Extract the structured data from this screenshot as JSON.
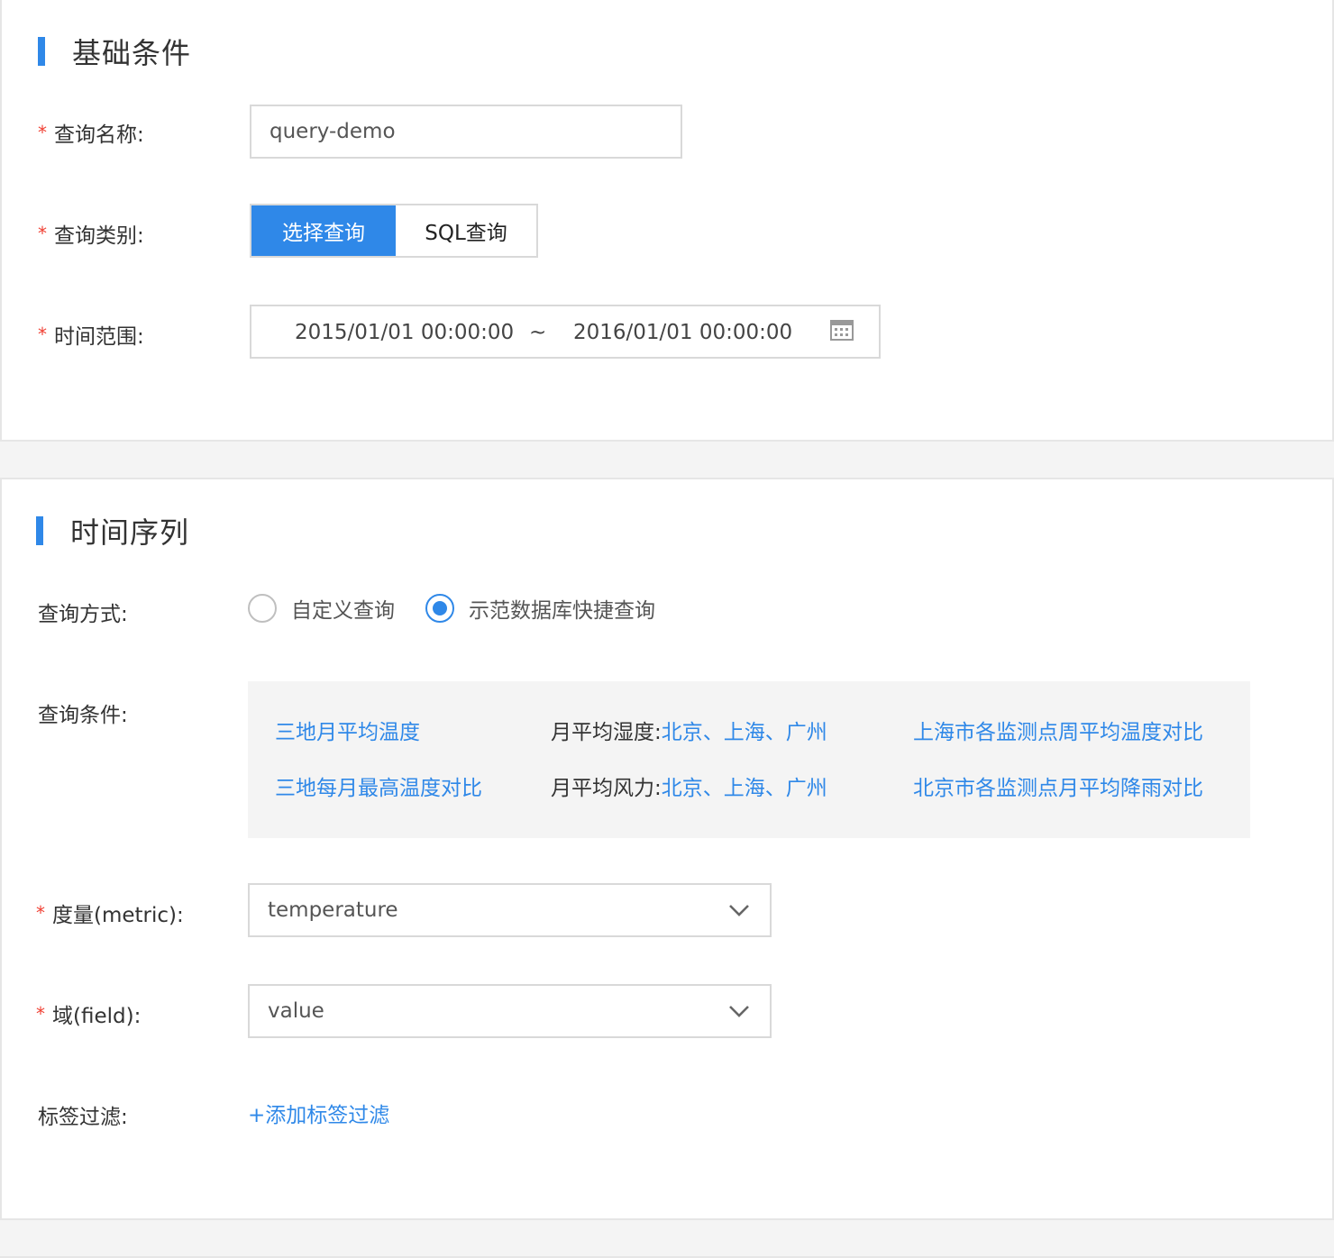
{
  "basic": {
    "title": "基础条件",
    "query_name": {
      "label": "查询名称:",
      "value": "query-demo"
    },
    "query_type": {
      "label": "查询类别:",
      "options": [
        "选择查询",
        "SQL查询"
      ],
      "selected": "选择查询"
    },
    "time_range": {
      "label": "时间范围:",
      "start": "2015/01/01 00:00:00",
      "separator": "~",
      "end": "2016/01/01 00:00:00"
    }
  },
  "timeseries": {
    "title": "时间序列",
    "query_mode": {
      "label": "查询方式:",
      "options": [
        "自定义查询",
        "示范数据库快捷查询"
      ],
      "selected": "示范数据库快捷查询"
    },
    "conditions": {
      "label": "查询条件:",
      "row1": {
        "c1": "三地月平均温度",
        "c2_prefix": "月平均湿度:",
        "c2_link": "北京、上海、广州",
        "c3": "上海市各监测点周平均温度对比"
      },
      "row2": {
        "c1": "三地每月最高温度对比",
        "c2_prefix": "月平均风力:",
        "c2_link": "北京、上海、广州",
        "c3": "北京市各监测点月平均降雨对比"
      }
    },
    "metric": {
      "label": "度量(metric):",
      "value": "temperature"
    },
    "field": {
      "label": "域(field):",
      "value": "value"
    },
    "tag_filter": {
      "label": "标签过滤:",
      "add_label": "+添加标签过滤"
    }
  },
  "colors": {
    "accent": "#2f88e8",
    "required": "#f04134",
    "border": "#d9d9d9"
  }
}
